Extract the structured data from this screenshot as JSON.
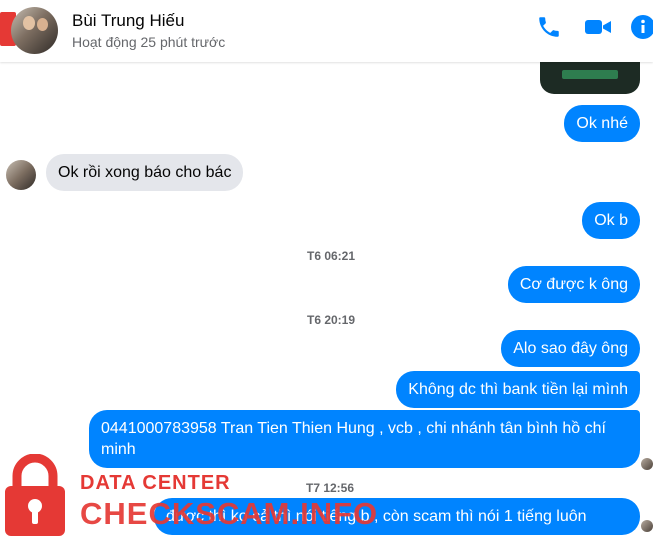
{
  "header": {
    "name": "Bùi Trung Hiếu",
    "status": "Hoạt động 25 phút trước",
    "icons": [
      "phone-icon",
      "video-icon",
      "info-icon"
    ],
    "accent": "#0084ff"
  },
  "messages": {
    "out_1": "Ok nhé",
    "in_1": "Ok rồi xong báo cho bác",
    "out_2": "Ok b",
    "ts_1": "T6 06:21",
    "out_3": "Cơ được k ông",
    "ts_2": "T6 20:19",
    "out_4": "Alo sao đây ông",
    "out_5": "Không dc thì bank tiền lại mình",
    "out_6_line1": "0441000783958 Tran Tien Thien Hung , vcb , chi nhánh tân bình hồ chí",
    "out_6_line2": "minh",
    "ts_3": "T7 12:56",
    "out_7": "được thì ko cả thì nói tiếng b , còn scam thì nói 1 tiếng luôn"
  },
  "watermark": {
    "line1": "DATA CENTER",
    "line2": "CHECKSCAM.INFO",
    "color": "#e53935"
  }
}
